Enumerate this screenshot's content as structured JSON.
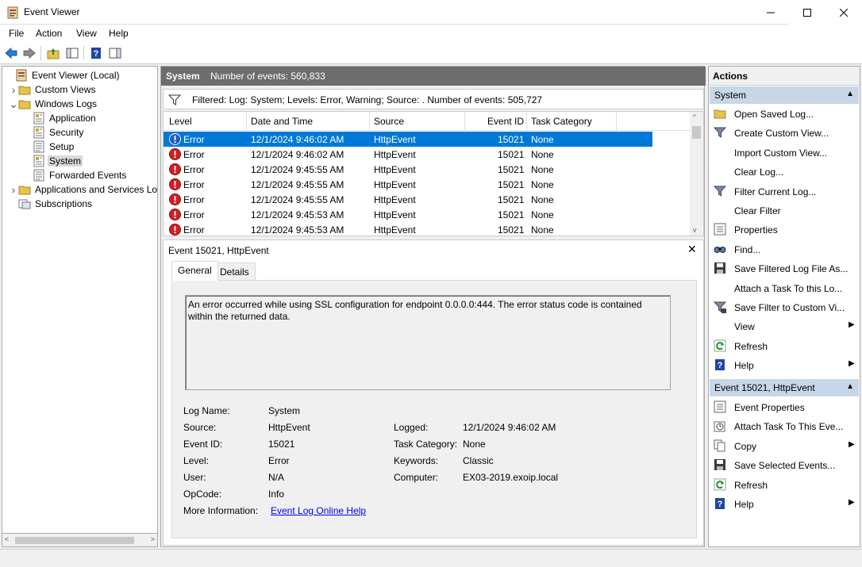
{
  "window": {
    "title": "Event Viewer"
  },
  "menu": [
    "File",
    "Action",
    "View",
    "Help"
  ],
  "tree": {
    "items": [
      {
        "label": "Event Viewer (Local)",
        "indent": 0,
        "arrow": ""
      },
      {
        "label": "Custom Views",
        "indent": 1,
        "arrow": ">"
      },
      {
        "label": "Windows Logs",
        "indent": 1,
        "arrow": "v"
      },
      {
        "label": "Application",
        "indent": 2,
        "arrow": ""
      },
      {
        "label": "Security",
        "indent": 2,
        "arrow": ""
      },
      {
        "label": "Setup",
        "indent": 2,
        "arrow": ""
      },
      {
        "label": "System",
        "indent": 2,
        "arrow": "",
        "selected": true
      },
      {
        "label": "Forwarded Events",
        "indent": 2,
        "arrow": ""
      },
      {
        "label": "Applications and Services Lo",
        "indent": 1,
        "arrow": ">"
      },
      {
        "label": "Subscriptions",
        "indent": 1,
        "arrow": ""
      }
    ]
  },
  "log": {
    "name": "System",
    "count_text": "Number of events: 560,833",
    "filter_text": "Filtered: Log: System; Levels: Error, Warning; Source: . Number of events: 505,727"
  },
  "grid": {
    "columns": [
      "Level",
      "Date and Time",
      "Source",
      "Event ID",
      "Task Category"
    ],
    "rows": [
      {
        "level": "Error",
        "date": "12/1/2024 9:46:02 AM",
        "source": "HttpEvent",
        "id": "15021",
        "category": "None"
      },
      {
        "level": "Error",
        "date": "12/1/2024 9:46:02 AM",
        "source": "HttpEvent",
        "id": "15021",
        "category": "None"
      },
      {
        "level": "Error",
        "date": "12/1/2024 9:45:55 AM",
        "source": "HttpEvent",
        "id": "15021",
        "category": "None"
      },
      {
        "level": "Error",
        "date": "12/1/2024 9:45:55 AM",
        "source": "HttpEvent",
        "id": "15021",
        "category": "None"
      },
      {
        "level": "Error",
        "date": "12/1/2024 9:45:55 AM",
        "source": "HttpEvent",
        "id": "15021",
        "category": "None"
      },
      {
        "level": "Error",
        "date": "12/1/2024 9:45:53 AM",
        "source": "HttpEvent",
        "id": "15021",
        "category": "None"
      },
      {
        "level": "Error",
        "date": "12/1/2024 9:45:53 AM",
        "source": "HttpEvent",
        "id": "15021",
        "category": "None"
      }
    ]
  },
  "detail": {
    "title": "Event 15021, HttpEvent",
    "tabs": [
      "General",
      "Details"
    ],
    "message": "An error occurred while using SSL configuration for endpoint 0.0.0.0:444.  The error status code is contained within the returned data.",
    "fields": {
      "log_name_label": "Log Name:",
      "log_name": "System",
      "source_label": "Source:",
      "source": "HttpEvent",
      "logged_label": "Logged:",
      "logged": "12/1/2024 9:46:02 AM",
      "event_id_label": "Event ID:",
      "event_id": "15021",
      "task_category_label": "Task Category:",
      "task_category": "None",
      "level_label": "Level:",
      "level": "Error",
      "keywords_label": "Keywords:",
      "keywords": "Classic",
      "user_label": "User:",
      "user": "N/A",
      "computer_label": "Computer:",
      "computer": "EX03-2019.exoip.local",
      "opcode_label": "OpCode:",
      "opcode": "Info",
      "more_info_label": "More Information:",
      "more_info_link": "Event Log Online Help"
    }
  },
  "actions": {
    "header": "Actions",
    "section1": {
      "title": "System",
      "items": [
        {
          "label": "Open Saved Log...",
          "icon": "folder-icon"
        },
        {
          "label": "Create Custom View...",
          "icon": "filter-icon"
        },
        {
          "label": "Import Custom View...",
          "icon": "none"
        },
        {
          "label": "Clear Log...",
          "icon": "none"
        },
        {
          "label": "Filter Current Log...",
          "icon": "filter-icon"
        },
        {
          "label": "Clear Filter",
          "icon": "none"
        },
        {
          "label": "Properties",
          "icon": "properties-icon"
        },
        {
          "label": "Find...",
          "icon": "find-icon"
        },
        {
          "label": "Save Filtered Log File As...",
          "icon": "save-icon"
        },
        {
          "label": "Attach a Task To this Lo...",
          "icon": "none"
        },
        {
          "label": "Save Filter to Custom Vi...",
          "icon": "filter-save-icon"
        },
        {
          "label": "View",
          "icon": "none",
          "submenu": true
        },
        {
          "label": "Refresh",
          "icon": "refresh-icon"
        },
        {
          "label": "Help",
          "icon": "help-icon",
          "submenu": true
        }
      ]
    },
    "section2": {
      "title": "Event 15021, HttpEvent",
      "items": [
        {
          "label": "Event Properties",
          "icon": "properties-icon"
        },
        {
          "label": "Attach Task To This Eve...",
          "icon": "task-icon"
        },
        {
          "label": "Copy",
          "icon": "copy-icon",
          "submenu": true
        },
        {
          "label": "Save Selected Events...",
          "icon": "save-icon"
        },
        {
          "label": "Refresh",
          "icon": "refresh-icon"
        },
        {
          "label": "Help",
          "icon": "help-icon",
          "submenu": true
        }
      ]
    }
  }
}
